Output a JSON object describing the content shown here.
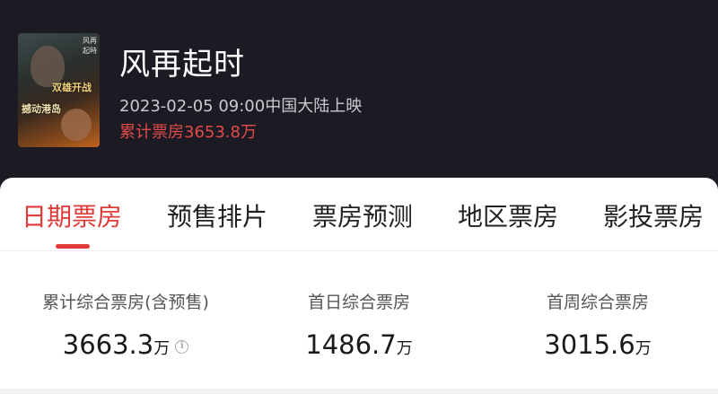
{
  "movie": {
    "title": "风再起时",
    "release": "2023-02-05 09:00中国大陆上映",
    "total_box_office": "累计票房3653.8万",
    "poster": {
      "tag_top": "双雄开战",
      "tag_bottom": "撼动港岛",
      "corner_text": "风再起時"
    }
  },
  "tabs": [
    {
      "label": "日期票房",
      "active": true
    },
    {
      "label": "预售排片",
      "active": false
    },
    {
      "label": "票房预测",
      "active": false
    },
    {
      "label": "地区票房",
      "active": false
    },
    {
      "label": "影投票房",
      "active": false
    }
  ],
  "stats": [
    {
      "label": "累计综合票房(含预售)",
      "value": "3663.3",
      "unit": "万",
      "has_info": true
    },
    {
      "label": "首日综合票房",
      "value": "1486.7",
      "unit": "万",
      "has_info": false
    },
    {
      "label": "首周综合票房",
      "value": "3015.6",
      "unit": "万",
      "has_info": false
    }
  ],
  "colors": {
    "header_bg": "#1c1b24",
    "accent_red": "#e03c3a",
    "total_text": "#e24a48"
  },
  "icons": {
    "info": "info-icon"
  }
}
